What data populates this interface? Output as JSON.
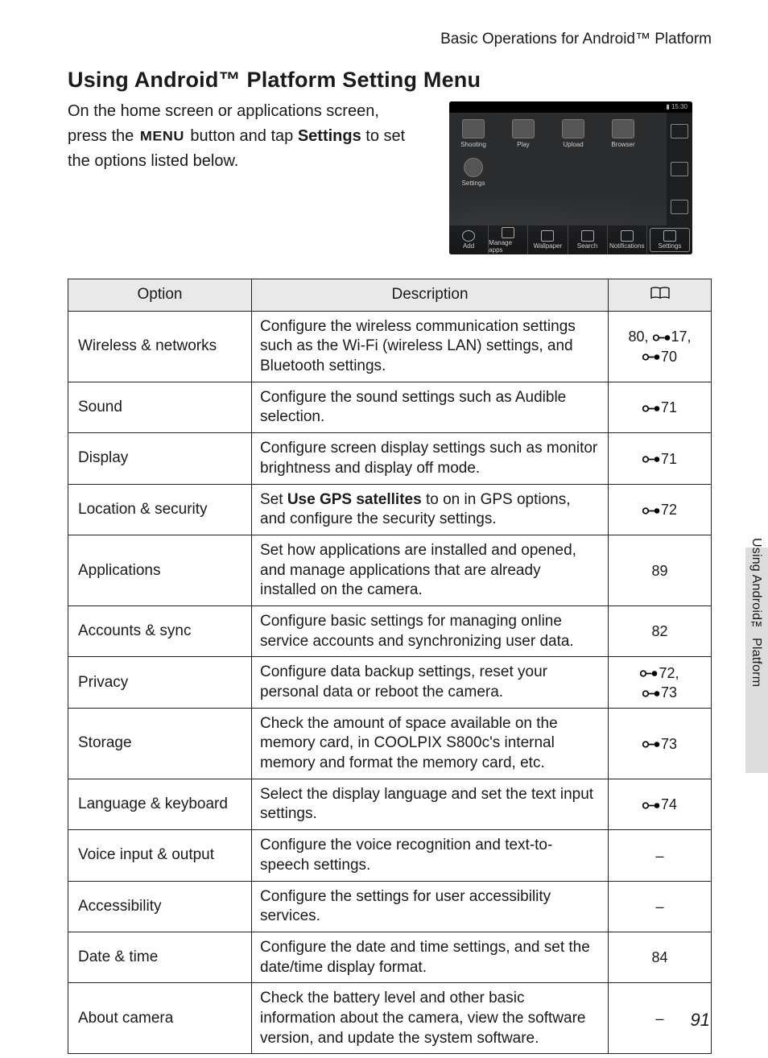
{
  "header": "Basic Operations for Android™ Platform",
  "title": "Using Android™ Platform Setting Menu",
  "intro_parts": {
    "p1": "On the home screen or applications screen, press the ",
    "menu": "MENU",
    "p2": " button and tap ",
    "settings": "Settings",
    "p3": " to set the options listed below."
  },
  "side_text": "Using Android™ Platform",
  "page_number": "91",
  "table": {
    "columns": {
      "option": "Option",
      "description": "Description"
    },
    "rows": [
      {
        "option": "Wireless & networks",
        "description": "Configure the wireless communication settings such as the Wi-Fi (wireless LAN) settings, and Bluetooth settings.",
        "ref": [
          {
            "segments": [
              {
                "text": "80, "
              },
              {
                "icon": true
              },
              {
                "text": "17,"
              }
            ]
          },
          {
            "segments": [
              {
                "icon": true
              },
              {
                "text": "70"
              }
            ]
          }
        ]
      },
      {
        "option": "Sound",
        "description": "Configure the sound settings such as Audible selection.",
        "ref": [
          {
            "segments": [
              {
                "icon": true
              },
              {
                "text": "71"
              }
            ]
          }
        ]
      },
      {
        "option": "Display",
        "description": "Configure screen display settings such as monitor brightness and display off mode.",
        "ref": [
          {
            "segments": [
              {
                "icon": true
              },
              {
                "text": "71"
              }
            ]
          }
        ]
      },
      {
        "option": "Location & security",
        "description_parts": {
          "p1": "Set ",
          "bold": "Use GPS satellites",
          "p2": " to on in GPS options, and configure the security settings."
        },
        "ref": [
          {
            "segments": [
              {
                "icon": true
              },
              {
                "text": "72"
              }
            ]
          }
        ]
      },
      {
        "option": "Applications",
        "description": "Set how applications are installed and opened, and manage applications that are already installed on the camera.",
        "ref": [
          {
            "segments": [
              {
                "text": "89"
              }
            ]
          }
        ]
      },
      {
        "option": "Accounts & sync",
        "description": "Configure basic settings for managing online service accounts and synchronizing user data.",
        "ref": [
          {
            "segments": [
              {
                "text": "82"
              }
            ]
          }
        ]
      },
      {
        "option": "Privacy",
        "description": "Configure data backup settings, reset your personal data or reboot the camera.",
        "ref": [
          {
            "segments": [
              {
                "icon": true
              },
              {
                "text": "72,"
              }
            ]
          },
          {
            "segments": [
              {
                "icon": true
              },
              {
                "text": "73"
              }
            ]
          }
        ]
      },
      {
        "option": "Storage",
        "description": "Check the amount of space available on the memory card, in COOLPIX S800c's internal memory and format the memory card, etc.",
        "ref": [
          {
            "segments": [
              {
                "icon": true
              },
              {
                "text": "73"
              }
            ]
          }
        ]
      },
      {
        "option": "Language & keyboard",
        "description": "Select the display language and set the text input settings.",
        "ref": [
          {
            "segments": [
              {
                "icon": true
              },
              {
                "text": "74"
              }
            ]
          }
        ]
      },
      {
        "option": "Voice input & output",
        "description": "Configure the voice recognition and text-to-speech settings.",
        "ref": [
          {
            "segments": [
              {
                "text": "–"
              }
            ]
          }
        ]
      },
      {
        "option": "Accessibility",
        "description": "Configure the settings for user accessibility services.",
        "ref": [
          {
            "segments": [
              {
                "text": "–"
              }
            ]
          }
        ]
      },
      {
        "option": "Date & time",
        "description": "Configure the date and time settings, and set the date/time display format.",
        "ref": [
          {
            "segments": [
              {
                "text": "84"
              }
            ]
          }
        ]
      },
      {
        "option": "About camera",
        "description": "Check the battery level and other basic information about the camera, view the software version, and update the system software.",
        "ref": [
          {
            "segments": [
              {
                "text": "–"
              }
            ]
          }
        ]
      }
    ]
  },
  "screenshot": {
    "status_time": "15:30",
    "top_apps": [
      "Shooting",
      "Play",
      "Upload",
      "Browser"
    ],
    "second_row_app": "Settings",
    "bottom": [
      "Add",
      "Manage apps",
      "Wallpaper",
      "Search",
      "Notifications",
      "Settings"
    ]
  }
}
